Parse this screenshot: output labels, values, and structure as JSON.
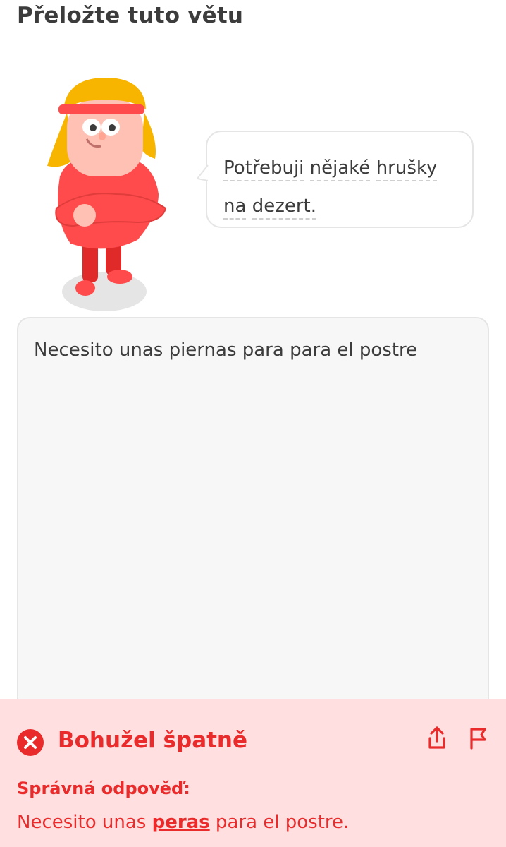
{
  "header": {
    "title": "Přeložte tuto větu"
  },
  "prompt": {
    "line1": [
      "Potřebuji",
      "nějaké",
      "hrušky"
    ],
    "line2": [
      "na",
      "dezert."
    ]
  },
  "answer": {
    "text": "Necesito unas piernas para para el postre"
  },
  "feedback": {
    "title": "Bohužel špatně",
    "label": "Správná odpověď:",
    "correct_before": "Necesito unas ",
    "correct_highlight": "peras",
    "correct_after": " para el postre.",
    "icons": [
      "close-circle-icon",
      "share-icon",
      "flag-icon"
    ]
  },
  "colors": {
    "error": "#ea2b2b",
    "feedback_bg": "#ffdfe0",
    "text": "#3c3c3c",
    "border": "#e5e5e5"
  }
}
